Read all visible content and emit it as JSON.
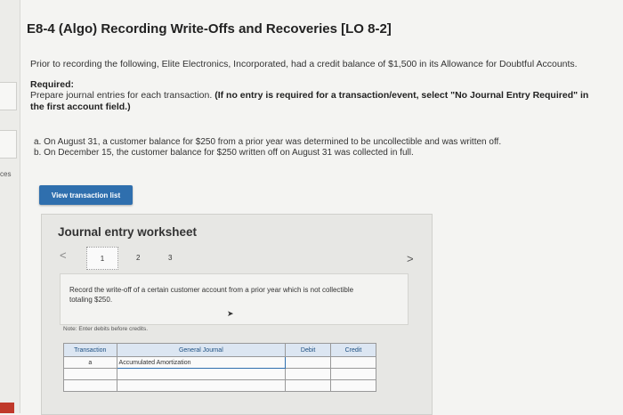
{
  "sidebar": {
    "label": "ces"
  },
  "page": {
    "title": "E8-4 (Algo) Recording Write-Offs and Recoveries [LO 8-2]",
    "intro": "Prior to recording the following, Elite Electronics, Incorporated, had a credit balance of $1,500 in its Allowance for Doubtful Accounts.",
    "required_heading": "Required:",
    "required_text": "Prepare journal entries for each transaction.",
    "required_bold": "(If no entry is required for a transaction/event, select \"No Journal Entry Required\" in the first account field.)",
    "items": [
      "a. On August 31, a customer balance for $250 from a prior year was determined to be uncollectible and was written off.",
      "b. On December 15, the customer balance for $250 written off on August 31 was collected in full."
    ],
    "view_button": "View transaction list"
  },
  "worksheet": {
    "title": "Journal entry worksheet",
    "prev": "<",
    "next": ">",
    "pages": [
      "1",
      "2",
      "3"
    ],
    "description": "Record the write-off of a certain customer account from a prior year which is not collectible totaling $250.",
    "note": "Note: Enter debits before credits.",
    "table": {
      "headers": [
        "Transaction",
        "General Journal",
        "Debit",
        "Credit"
      ],
      "rows": [
        [
          "a",
          "Accumulated Amortization",
          "",
          ""
        ],
        [
          "",
          "",
          "",
          ""
        ],
        [
          "",
          "",
          "",
          ""
        ]
      ]
    }
  }
}
